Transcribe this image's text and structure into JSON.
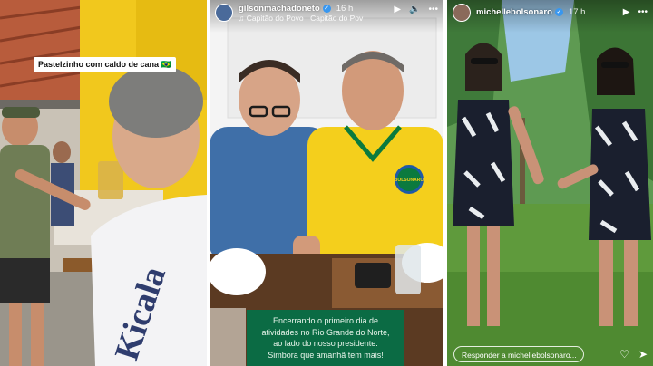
{
  "stories": [
    {
      "sticker_text": "Pastelzinho com caldo de cana 🇧🇷",
      "shirt_text": "Kicala"
    },
    {
      "username": "gilsonmachadoneto",
      "time": "16 h",
      "music": "♫ Capitão do Povo · Capitão do Pov",
      "play_icon": "▶",
      "sound_icon": "🔈",
      "more_icon": "•••",
      "badge_text": "BOLSONARO",
      "caption_lines": [
        "Encerrando o primeiro dia de",
        "atividades no Rio Grande do Norte,",
        "ao lado do nosso presidente.",
        "Simbora que amanhã tem mais!"
      ]
    },
    {
      "username": "michellebolsonaro",
      "time": "17 h",
      "play_icon": "▶",
      "more_icon": "•••",
      "reply_placeholder": "Responder a michellebolsonaro...",
      "heart_icon": "♡",
      "send_icon": "➤"
    }
  ],
  "colors": {
    "caption_green": "#0b6b44",
    "verified_blue": "#3897f0",
    "shirt_yellow": "#f4cf1c",
    "wall_yellow": "#f1c81d"
  }
}
